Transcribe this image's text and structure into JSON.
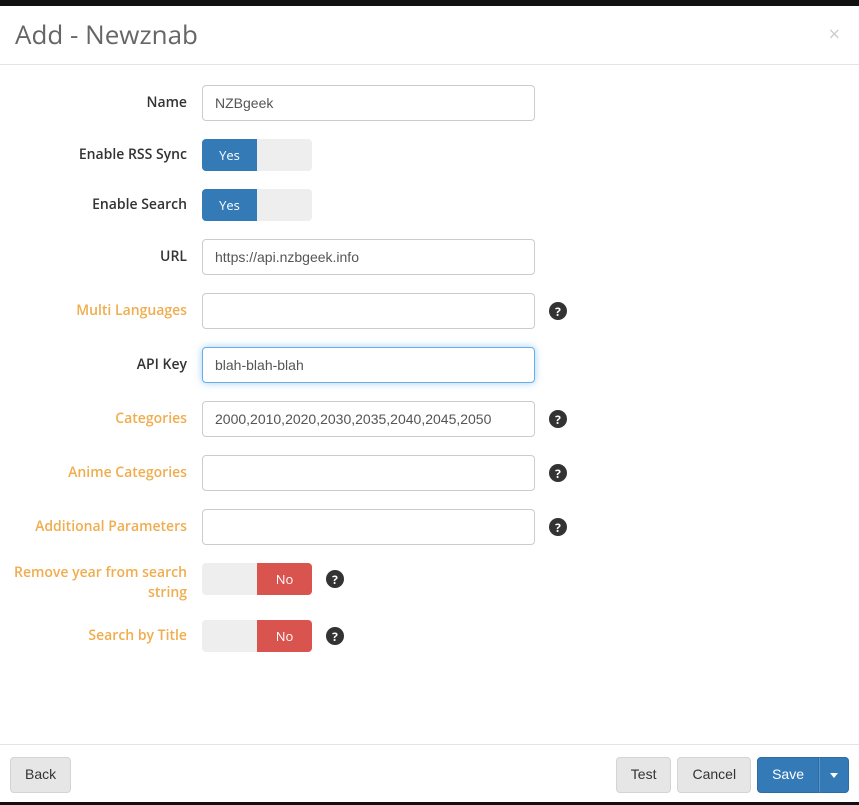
{
  "header": {
    "title": "Add - Newznab",
    "close_glyph": "×"
  },
  "form": {
    "name": {
      "label": "Name",
      "value": "NZBgeek"
    },
    "enable_rss": {
      "label": "Enable RSS Sync",
      "value": "Yes"
    },
    "enable_search": {
      "label": "Enable Search",
      "value": "Yes"
    },
    "url": {
      "label": "URL",
      "value": "https://api.nzbgeek.info"
    },
    "multi_languages": {
      "label": "Multi Languages",
      "value": ""
    },
    "api_key": {
      "label": "API Key",
      "value": "blah-blah-blah"
    },
    "categories": {
      "label": "Categories",
      "value": "2000,2010,2020,2030,2035,2040,2045,2050"
    },
    "anime_categories": {
      "label": "Anime Categories",
      "value": ""
    },
    "additional_parameters": {
      "label": "Additional Parameters",
      "value": ""
    },
    "remove_year": {
      "label": "Remove year from search string",
      "value": "No"
    },
    "search_by_title": {
      "label": "Search by Title",
      "value": "No"
    }
  },
  "toggle": {
    "yes": "Yes",
    "no": "No"
  },
  "help_glyph": "?",
  "footer": {
    "back": "Back",
    "test": "Test",
    "cancel": "Cancel",
    "save": "Save"
  }
}
